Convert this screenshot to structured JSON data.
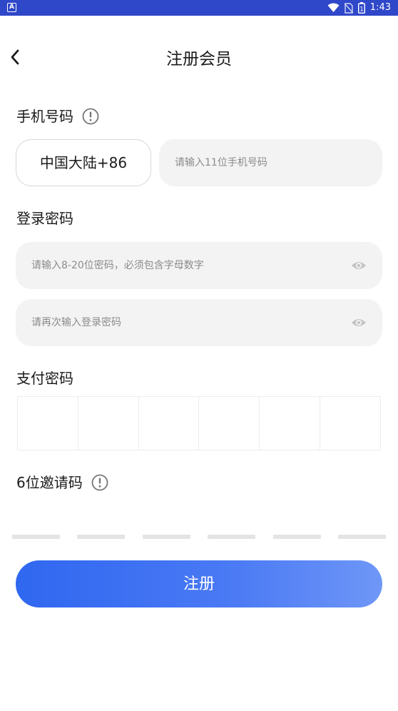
{
  "status_bar": {
    "app_badge": "A",
    "time": "1:43",
    "battery_level": "1"
  },
  "header": {
    "title": "注册会员"
  },
  "phone": {
    "label": "手机号码",
    "country_code": "中国大陆+86",
    "placeholder": "请输入11位手机号码"
  },
  "login_password": {
    "label": "登录密码",
    "placeholder": "请输入8-20位密码，必须包含字母数字",
    "confirm_placeholder": "请再次输入登录密码"
  },
  "pay_password": {
    "label": "支付密码",
    "cells": 6
  },
  "invite_code": {
    "label": "6位邀请码",
    "cells": 6
  },
  "register_button": {
    "label": "注册"
  },
  "colors": {
    "status_bar": "#2f47c9",
    "button_start": "#2f67f0",
    "button_end": "#6f97f7",
    "field_bg": "#f3f3f3"
  },
  "icons": [
    "wifi-icon",
    "no-sim-icon",
    "battery-icon",
    "back-arrow-icon",
    "info-icon",
    "eye-icon"
  ]
}
